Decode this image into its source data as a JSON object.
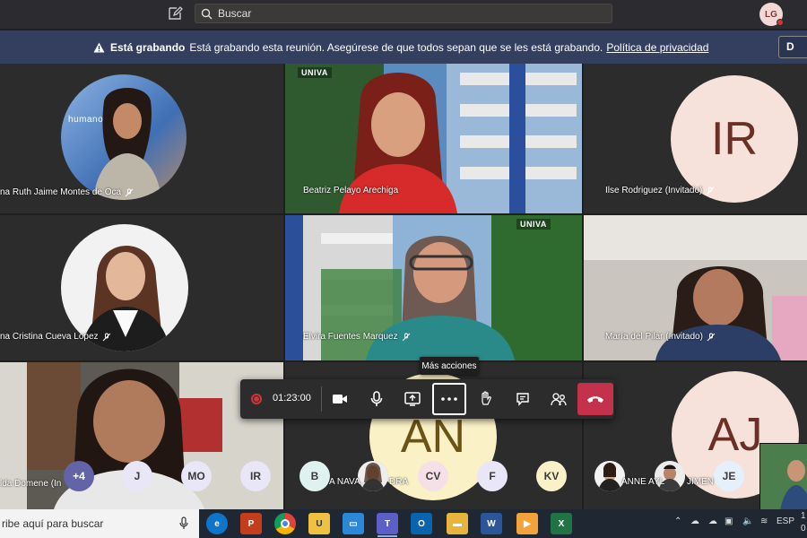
{
  "topbar": {
    "search_placeholder": "Buscar",
    "user_initials": "LG"
  },
  "banner": {
    "title": "Está grabando",
    "message": "Está grabando esta reunión. Asegúrese de que todos sepan que se les está grabando.",
    "link": "Política de privacidad",
    "dismiss": "D"
  },
  "participants": [
    {
      "name": "na Ruth Jaime Montes de Oca",
      "brand": "humano"
    },
    {
      "name": "Beatriz Pelayo Arechiga",
      "brand": "UNIVA"
    },
    {
      "name": "Ilse Rodriguez (Invitado)",
      "initials": "IR"
    },
    {
      "name": "na Cristina Cueva Lopez"
    },
    {
      "name": "Elvira Fuentes Marquez",
      "brand": "UNIVA"
    },
    {
      "name": "María del Pilar (Invitado)"
    },
    {
      "name": "lda Domene (In"
    },
    {
      "initials": "AN"
    },
    {
      "initials": "AJ"
    }
  ],
  "controls": {
    "timer": "01:23:00",
    "tooltip": "Más acciones"
  },
  "overflow_row": {
    "chips": [
      "+4",
      "J",
      "MO",
      "IR",
      "B",
      "CV",
      "F",
      "KV",
      "JE"
    ],
    "name_fragments": [
      "A NAVA,",
      "DRA",
      "ANNE AYL",
      "JIMEN"
    ]
  },
  "colors": {
    "accent": "#6264a7",
    "hangup": "#c4314b",
    "banner": "#343f60",
    "chip_bg": "#e8e6f7",
    "recording": "#d13438"
  },
  "taskbar": {
    "search_text": "ribe aquí para buscar",
    "language": "ESP",
    "apps": [
      "edge",
      "powerpoint",
      "chrome",
      "univa",
      "explorer",
      "teams",
      "outlook",
      "files",
      "word",
      "media",
      "excel"
    ],
    "clock_a": "1",
    "clock_b": "0"
  }
}
